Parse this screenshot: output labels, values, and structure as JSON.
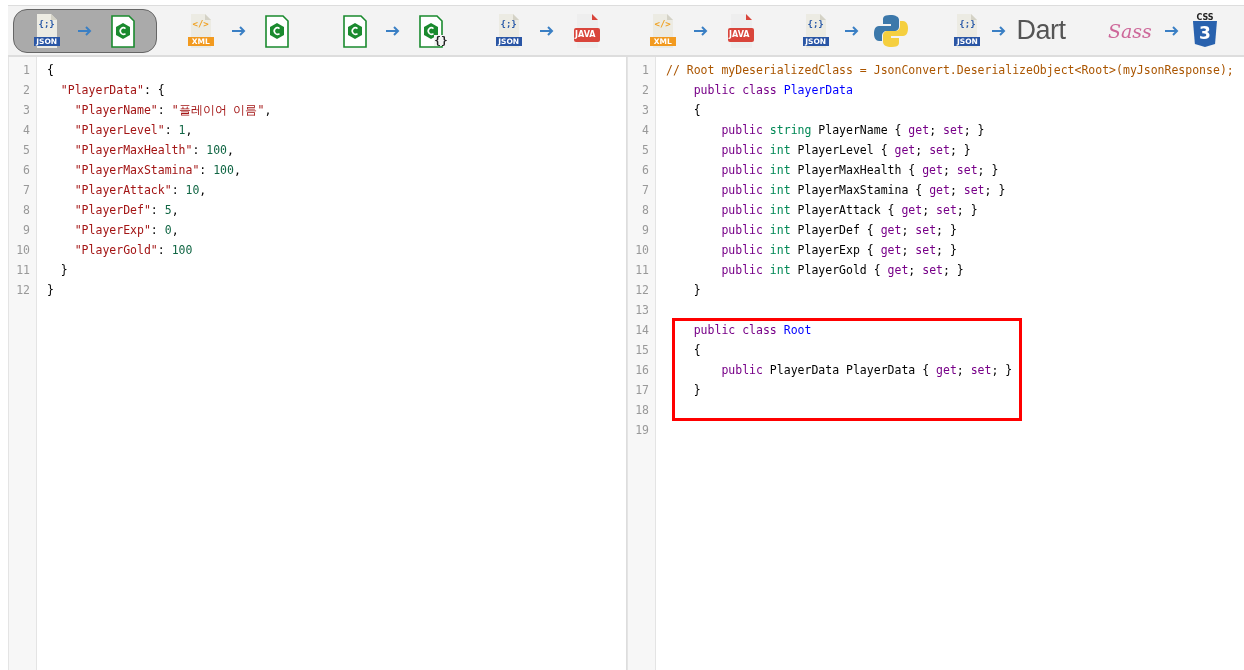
{
  "converters": [
    {
      "selected": true,
      "from": {
        "kind": "json",
        "glyph": "{;}",
        "label": "JSON"
      },
      "to": {
        "kind": "csharp"
      }
    },
    {
      "selected": false,
      "from": {
        "kind": "xml",
        "glyph": "</>",
        "label": "XML"
      },
      "to": {
        "kind": "csharp"
      }
    },
    {
      "selected": false,
      "from": {
        "kind": "csharp"
      },
      "to": {
        "kind": "csharp-braces",
        "glyph": "{}"
      }
    },
    {
      "selected": false,
      "from": {
        "kind": "json",
        "glyph": "{;}",
        "label": "JSON"
      },
      "to": {
        "kind": "java",
        "label": "JAVA"
      }
    },
    {
      "selected": false,
      "from": {
        "kind": "xml",
        "glyph": "</>",
        "label": "XML"
      },
      "to": {
        "kind": "java",
        "label": "JAVA"
      }
    },
    {
      "selected": false,
      "from": {
        "kind": "json",
        "glyph": "{;}",
        "label": "JSON"
      },
      "to": {
        "kind": "python"
      }
    },
    {
      "selected": false,
      "from": {
        "kind": "json",
        "glyph": "{;}",
        "label": "JSON"
      },
      "to": {
        "kind": "dart",
        "label": "Dart"
      }
    },
    {
      "selected": false,
      "from": {
        "kind": "sass",
        "label": "Sass"
      },
      "to": {
        "kind": "css",
        "label": "CSS",
        "glyph": "3"
      }
    }
  ],
  "input_editor": {
    "lines": [
      {
        "number": "1",
        "tokens": [
          {
            "kind": "punct",
            "text": "{"
          }
        ]
      },
      {
        "number": "2",
        "tokens": [
          {
            "kind": "str",
            "text": "  \"PlayerData\""
          },
          {
            "kind": "punct",
            "text": ": {"
          }
        ]
      },
      {
        "number": "3",
        "tokens": [
          {
            "kind": "str",
            "text": "    \"PlayerName\""
          },
          {
            "kind": "punct",
            "text": ": "
          },
          {
            "kind": "str",
            "text": "\"플레이어 이름\""
          },
          {
            "kind": "punct",
            "text": ","
          }
        ]
      },
      {
        "number": "4",
        "tokens": [
          {
            "kind": "str",
            "text": "    \"PlayerLevel\""
          },
          {
            "kind": "punct",
            "text": ": "
          },
          {
            "kind": "num",
            "text": "1"
          },
          {
            "kind": "punct",
            "text": ","
          }
        ]
      },
      {
        "number": "5",
        "tokens": [
          {
            "kind": "str",
            "text": "    \"PlayerMaxHealth\""
          },
          {
            "kind": "punct",
            "text": ": "
          },
          {
            "kind": "num",
            "text": "100"
          },
          {
            "kind": "punct",
            "text": ","
          }
        ]
      },
      {
        "number": "6",
        "tokens": [
          {
            "kind": "str",
            "text": "    \"PlayerMaxStamina\""
          },
          {
            "kind": "punct",
            "text": ": "
          },
          {
            "kind": "num",
            "text": "100"
          },
          {
            "kind": "punct",
            "text": ","
          }
        ]
      },
      {
        "number": "7",
        "tokens": [
          {
            "kind": "str",
            "text": "    \"PlayerAttack\""
          },
          {
            "kind": "punct",
            "text": ": "
          },
          {
            "kind": "num",
            "text": "10"
          },
          {
            "kind": "punct",
            "text": ","
          }
        ]
      },
      {
        "number": "8",
        "tokens": [
          {
            "kind": "str",
            "text": "    \"PlayerDef\""
          },
          {
            "kind": "punct",
            "text": ": "
          },
          {
            "kind": "num",
            "text": "5"
          },
          {
            "kind": "punct",
            "text": ","
          }
        ]
      },
      {
        "number": "9",
        "tokens": [
          {
            "kind": "str",
            "text": "    \"PlayerExp\""
          },
          {
            "kind": "punct",
            "text": ": "
          },
          {
            "kind": "num",
            "text": "0"
          },
          {
            "kind": "punct",
            "text": ","
          }
        ]
      },
      {
        "number": "10",
        "tokens": [
          {
            "kind": "str",
            "text": "    \"PlayerGold\""
          },
          {
            "kind": "punct",
            "text": ": "
          },
          {
            "kind": "num",
            "text": "100"
          }
        ]
      },
      {
        "number": "11",
        "tokens": [
          {
            "kind": "punct",
            "text": "  }"
          }
        ]
      },
      {
        "number": "12",
        "tokens": [
          {
            "kind": "punct",
            "text": "}"
          }
        ]
      }
    ]
  },
  "output_editor": {
    "lines": [
      {
        "number": "1",
        "highlighted": false,
        "tokens": [
          {
            "kind": "comment",
            "text": "// Root myDeserializedClass = JsonConvert.DeserializeObject<Root>(myJsonResponse);"
          }
        ]
      },
      {
        "number": "2",
        "highlighted": false,
        "tokens": [
          {
            "kind": "kw",
            "text": "    public class "
          },
          {
            "kind": "cls",
            "text": "PlayerData"
          }
        ]
      },
      {
        "number": "3",
        "highlighted": false,
        "tokens": [
          {
            "kind": "punct",
            "text": "    {"
          }
        ]
      },
      {
        "number": "4",
        "highlighted": false,
        "tokens": [
          {
            "kind": "kw",
            "text": "        public "
          },
          {
            "kind": "type",
            "text": "string "
          },
          {
            "kind": "punct",
            "text": "PlayerName { "
          },
          {
            "kind": "kw",
            "text": "get"
          },
          {
            "kind": "punct",
            "text": "; "
          },
          {
            "kind": "kw",
            "text": "set"
          },
          {
            "kind": "punct",
            "text": "; }"
          }
        ]
      },
      {
        "number": "5",
        "highlighted": false,
        "tokens": [
          {
            "kind": "kw",
            "text": "        public "
          },
          {
            "kind": "type",
            "text": "int "
          },
          {
            "kind": "punct",
            "text": "PlayerLevel { "
          },
          {
            "kind": "kw",
            "text": "get"
          },
          {
            "kind": "punct",
            "text": "; "
          },
          {
            "kind": "kw",
            "text": "set"
          },
          {
            "kind": "punct",
            "text": "; }"
          }
        ]
      },
      {
        "number": "6",
        "highlighted": false,
        "tokens": [
          {
            "kind": "kw",
            "text": "        public "
          },
          {
            "kind": "type",
            "text": "int "
          },
          {
            "kind": "punct",
            "text": "PlayerMaxHealth { "
          },
          {
            "kind": "kw",
            "text": "get"
          },
          {
            "kind": "punct",
            "text": "; "
          },
          {
            "kind": "kw",
            "text": "set"
          },
          {
            "kind": "punct",
            "text": "; }"
          }
        ]
      },
      {
        "number": "7",
        "highlighted": false,
        "tokens": [
          {
            "kind": "kw",
            "text": "        public "
          },
          {
            "kind": "type",
            "text": "int "
          },
          {
            "kind": "punct",
            "text": "PlayerMaxStamina { "
          },
          {
            "kind": "kw",
            "text": "get"
          },
          {
            "kind": "punct",
            "text": "; "
          },
          {
            "kind": "kw",
            "text": "set"
          },
          {
            "kind": "punct",
            "text": "; }"
          }
        ]
      },
      {
        "number": "8",
        "highlighted": false,
        "tokens": [
          {
            "kind": "kw",
            "text": "        public "
          },
          {
            "kind": "type",
            "text": "int "
          },
          {
            "kind": "punct",
            "text": "PlayerAttack { "
          },
          {
            "kind": "kw",
            "text": "get"
          },
          {
            "kind": "punct",
            "text": "; "
          },
          {
            "kind": "kw",
            "text": "set"
          },
          {
            "kind": "punct",
            "text": "; }"
          }
        ]
      },
      {
        "number": "9",
        "highlighted": false,
        "tokens": [
          {
            "kind": "kw",
            "text": "        public "
          },
          {
            "kind": "type",
            "text": "int "
          },
          {
            "kind": "punct",
            "text": "PlayerDef { "
          },
          {
            "kind": "kw",
            "text": "get"
          },
          {
            "kind": "punct",
            "text": "; "
          },
          {
            "kind": "kw",
            "text": "set"
          },
          {
            "kind": "punct",
            "text": "; }"
          }
        ]
      },
      {
        "number": "10",
        "highlighted": false,
        "tokens": [
          {
            "kind": "kw",
            "text": "        public "
          },
          {
            "kind": "type",
            "text": "int "
          },
          {
            "kind": "punct",
            "text": "PlayerExp { "
          },
          {
            "kind": "kw",
            "text": "get"
          },
          {
            "kind": "punct",
            "text": "; "
          },
          {
            "kind": "kw",
            "text": "set"
          },
          {
            "kind": "punct",
            "text": "; }"
          }
        ]
      },
      {
        "number": "11",
        "highlighted": false,
        "tokens": [
          {
            "kind": "kw",
            "text": "        public "
          },
          {
            "kind": "type",
            "text": "int "
          },
          {
            "kind": "punct",
            "text": "PlayerGold { "
          },
          {
            "kind": "kw",
            "text": "get"
          },
          {
            "kind": "punct",
            "text": "; "
          },
          {
            "kind": "kw",
            "text": "set"
          },
          {
            "kind": "punct",
            "text": "; }"
          }
        ]
      },
      {
        "number": "12",
        "highlighted": false,
        "tokens": [
          {
            "kind": "punct",
            "text": "    }"
          }
        ]
      },
      {
        "number": "13",
        "highlighted": false
      },
      {
        "number": "14",
        "highlighted": true,
        "tokens": [
          {
            "kind": "kw",
            "text": "    public class "
          },
          {
            "kind": "cls",
            "text": "Root"
          }
        ]
      },
      {
        "number": "15",
        "highlighted": true,
        "tokens": [
          {
            "kind": "punct",
            "text": "    {"
          }
        ]
      },
      {
        "number": "16",
        "highlighted": true,
        "tokens": [
          {
            "kind": "kw",
            "text": "        public "
          },
          {
            "kind": "punct",
            "text": "PlayerData PlayerData { "
          },
          {
            "kind": "kw",
            "text": "get"
          },
          {
            "kind": "punct",
            "text": "; "
          },
          {
            "kind": "kw",
            "text": "set"
          },
          {
            "kind": "punct",
            "text": "; }"
          }
        ]
      },
      {
        "number": "17",
        "highlighted": true,
        "tokens": [
          {
            "kind": "punct",
            "text": "    }"
          }
        ]
      },
      {
        "number": "18",
        "highlighted": true
      },
      {
        "number": "19",
        "highlighted": false
      }
    ]
  }
}
